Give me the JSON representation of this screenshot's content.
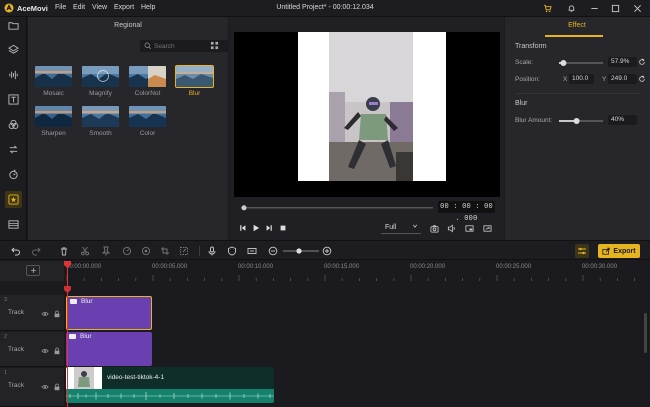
{
  "app": {
    "name": "AceMovi",
    "window_title": "Untitled Project* - 00:00:12.034"
  },
  "menu": [
    "File",
    "Edit",
    "View",
    "Export",
    "Help"
  ],
  "colors": {
    "accent": "#e6b420",
    "clip_purple": "#6a3fb0",
    "clip_teal": "#17806e",
    "playhead": "#dd3333"
  },
  "sidebar": {
    "items": [
      {
        "icon": "folder-icon"
      },
      {
        "icon": "layers-icon"
      },
      {
        "icon": "audio-icon"
      },
      {
        "icon": "text-icon"
      },
      {
        "icon": "filters-icon"
      },
      {
        "icon": "transitions-icon"
      },
      {
        "icon": "elements-icon"
      },
      {
        "icon": "effects-icon",
        "active": true
      },
      {
        "icon": "templates-icon"
      }
    ]
  },
  "library": {
    "title": "Regional",
    "search_placeholder": "Search",
    "effects": [
      {
        "label": "Mosaic"
      },
      {
        "label": "Magnify"
      },
      {
        "label": "ColorNot"
      },
      {
        "label": "Blur",
        "selected": true
      },
      {
        "label": "Sharpen"
      },
      {
        "label": "Smooth"
      },
      {
        "label": "Color"
      }
    ]
  },
  "preview": {
    "timecode": "00 : 00 : 00 . 000",
    "quality": "Full"
  },
  "effect_panel": {
    "tab": "Effect",
    "transform": {
      "title": "Transform",
      "scale_label": "Scale:",
      "scale_value": "57.9%",
      "scale_fraction": 0.1,
      "position_label": "Position:",
      "x_label": "X",
      "x_value": "100.0",
      "y_label": "Y",
      "y_value": "249.0"
    },
    "blur": {
      "title": "Blur",
      "amount_label": "Blur Amount:",
      "amount_value": "40%",
      "amount_fraction": 0.4
    }
  },
  "toolbar": {
    "export_label": "Export"
  },
  "timeline": {
    "ruler": [
      "00:00:00.000",
      "00:00:05.000",
      "00:00:10.000",
      "00:00:15.000",
      "00:00:20.000",
      "00:00:25.000",
      "00:00:30.000"
    ],
    "tracks": [
      {
        "index": "3",
        "name": "Track",
        "clip": "Blur"
      },
      {
        "index": "2",
        "name": "Track",
        "clip": "Blur"
      },
      {
        "index": "1",
        "name": "Track",
        "clip": "video-test-tiktok-4-1"
      }
    ]
  }
}
